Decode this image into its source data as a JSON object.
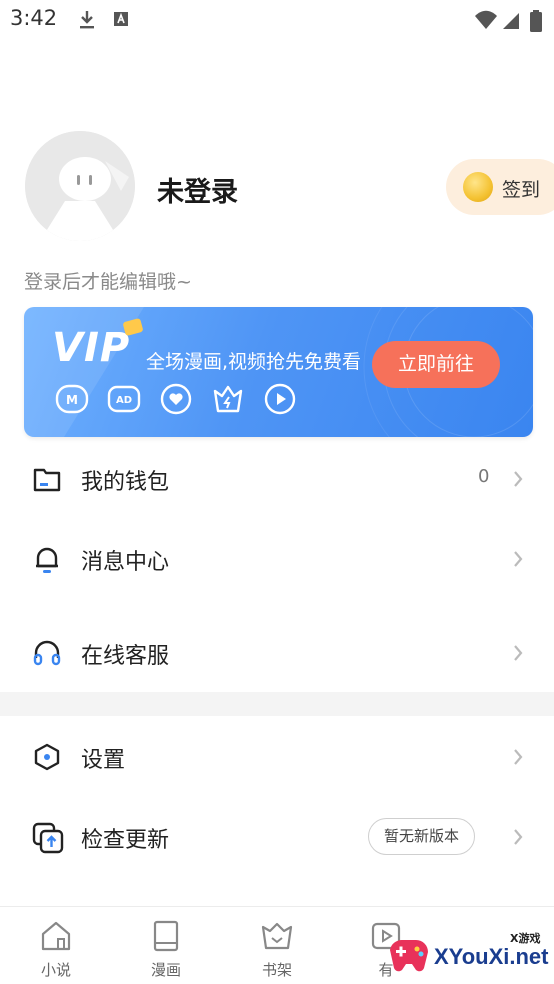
{
  "status_bar": {
    "time": "3:42"
  },
  "profile": {
    "username": "未登录",
    "hint": "登录后才能编辑哦~",
    "checkin_label": "签到"
  },
  "vip": {
    "logo": "VIP",
    "promo_text": "全场漫画,视频抢先免费看",
    "button_label": "立即前往",
    "icons": [
      "comic-icon",
      "ad-icon",
      "heart-icon",
      "crown-icon",
      "play-icon"
    ]
  },
  "menu": {
    "wallet": {
      "label": "我的钱包",
      "value": "0"
    },
    "messages": {
      "label": "消息中心"
    },
    "support": {
      "label": "在线客服"
    },
    "settings": {
      "label": "设置"
    },
    "update": {
      "label": "检查更新",
      "badge": "暂无新版本"
    }
  },
  "bottom_nav": {
    "tabs": [
      {
        "label": "小说",
        "icon": "house-icon"
      },
      {
        "label": "漫画",
        "icon": "book-icon"
      },
      {
        "label": "书架",
        "icon": "shelf-icon"
      },
      {
        "label": "有",
        "icon": "video-icon"
      }
    ]
  },
  "watermark": {
    "text": "XYouXi.net",
    "small": "X游戏"
  },
  "colors": {
    "accent": "#4f95f5",
    "vip_button": "#f6715a",
    "checkin_bg": "#fdeedd"
  }
}
